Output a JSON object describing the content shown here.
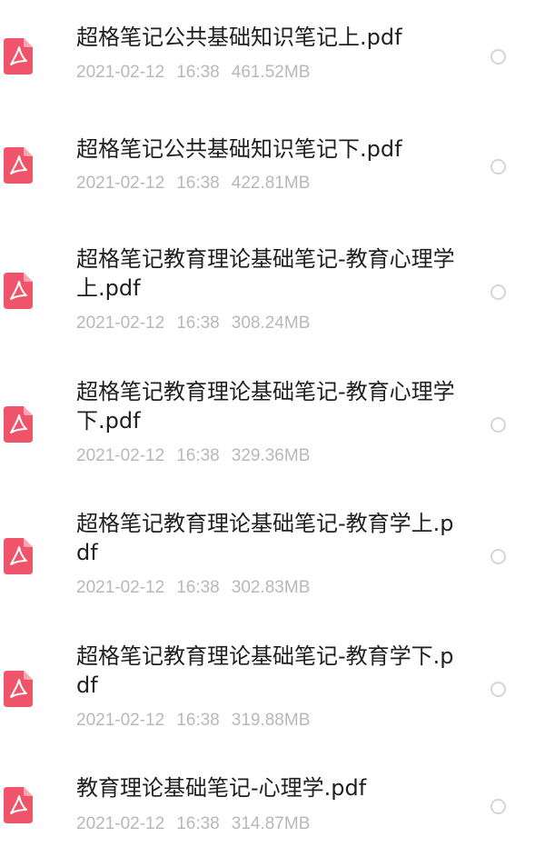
{
  "files": [
    {
      "name": "超格笔记公共基础知识笔记上.pdf",
      "date": "2021-02-12",
      "time": "16:38",
      "size": "461.52MB"
    },
    {
      "name": "超格笔记公共基础知识笔记下.pdf",
      "date": "2021-02-12",
      "time": "16:38",
      "size": "422.81MB"
    },
    {
      "name": "超格笔记教育理论基础笔记-教育心理学 上.pdf",
      "date": "2021-02-12",
      "time": "16:38",
      "size": "308.24MB"
    },
    {
      "name": "超格笔记教育理论基础笔记-教育心理学下.pdf",
      "date": "2021-02-12",
      "time": "16:38",
      "size": "329.36MB"
    },
    {
      "name": "超格笔记教育理论基础笔记-教育学上.pdf",
      "date": "2021-02-12",
      "time": "16:38",
      "size": "302.83MB"
    },
    {
      "name": "超格笔记教育理论基础笔记-教育学下.pdf",
      "date": "2021-02-12",
      "time": "16:38",
      "size": "319.88MB"
    },
    {
      "name": "教育理论基础笔记-心理学.pdf",
      "date": "2021-02-12",
      "time": "16:38",
      "size": "314.87MB"
    }
  ],
  "icons": {
    "file_type": "pdf-file-icon",
    "selection": "radio-circle-icon"
  },
  "colors": {
    "pdf_icon": "#f0546a",
    "name_text": "#1f1f1f",
    "meta_text": "#b8b8b8",
    "radio_border": "#d6d6d6"
  }
}
